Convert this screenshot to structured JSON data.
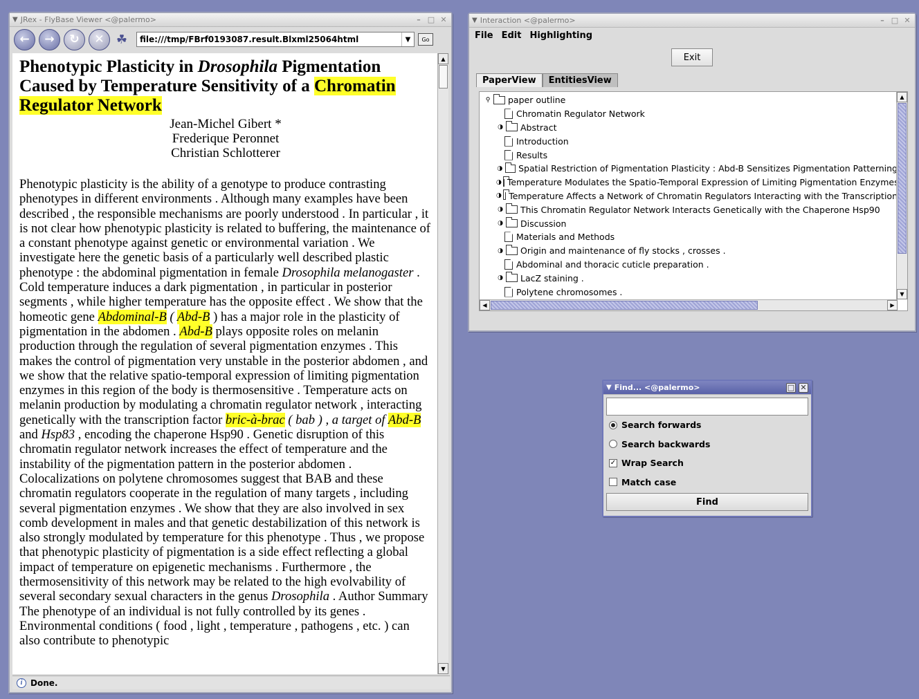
{
  "jrex": {
    "title": "JRex - FlyBase Viewer <@palermo>",
    "url": "file:///tmp/FBrf0193087.result.Blxml25064html",
    "go_label": "Go",
    "status": "Done.",
    "nav_icons": [
      "back-icon",
      "forward-icon",
      "reload-icon",
      "stop-icon",
      "home-icon"
    ]
  },
  "paper": {
    "title_plain_1": "Phenotypic Plasticity in ",
    "title_italic": "Drosophila",
    "title_plain_2": " Pigmentation Caused by Temperature Sensitivity of a ",
    "title_highlight": "Chromatin Regulator Network",
    "authors": [
      "Jean-Michel Gibert *",
      "Frederique Peronnet",
      "Christian Schlotterer"
    ],
    "abstract": {
      "p1": "Phenotypic plasticity is the ability of a genotype to produce contrasting phenotypes in different environments . Although many examples have been described , the responsible mechanisms are poorly understood . In particular , it is not clear how phenotypic plasticity is related to buffering, the maintenance of a constant phenotype against genetic or environmental variation . We investigate here the genetic basis of a particularly well described plastic phenotype : the abdominal pigmentation in female ",
      "i1": "Drosophila melanogaster",
      "p2": " . Cold temperature induces a dark pigmentation , in particular in posterior segments , while higher temperature has the opposite effect . We show that the homeotic gene ",
      "h1": "Abdominal-B",
      "p3": " ( ",
      "h2": "Abd-B",
      "p4": " ) has a major role in the plasticity of pigmentation in the abdomen . ",
      "h3": "Abd-B",
      "p5": " plays opposite roles on melanin production through the regulation of several pigmentation enzymes . This makes the control of pigmentation very unstable in the posterior abdomen , and we show that the relative spatio-temporal expression of limiting pigmentation enzymes in this region of the body is thermosensitive . Temperature acts on melanin production by modulating a chromatin regulator network , interacting genetically with the transcription factor ",
      "h4": "bric-à-brac",
      "p6": " ( bab ) , a target of ",
      "h5": "Abd-B",
      "p7": " and ",
      "i2": "Hsp83",
      "p8": " , encoding the chaperone Hsp90 . Genetic disruption of this chromatin regulator network increases the effect of temperature and the instability of the pigmentation pattern in the posterior abdomen . Colocalizations on polytene chromosomes suggest that BAB and these chromatin regulators cooperate in the regulation of many targets , including several pigmentation enzymes . We show that they are also involved in sex comb development in males and that genetic destabilization of this network is also strongly modulated by temperature for this phenotype . Thus , we propose that phenotypic plasticity of pigmentation is a side effect reflecting a global impact of temperature on epigenetic mechanisms . Furthermore , the thermosensitivity of this network may be related to the high evolvability of several secondary sexual characters in the genus ",
      "i3": "Drosophila",
      "p9": " . Author Summary The phenotype of an individual is not fully controlled by its genes . Environmental conditions ( food , light , temperature , pathogens , etc. ) can also contribute to phenotypic"
    }
  },
  "interaction": {
    "title": "Interaction <@palermo>",
    "menu": [
      "File",
      "Edit",
      "Highlighting"
    ],
    "exit_label": "Exit",
    "tabs": [
      "PaperView",
      "EntitiesView"
    ],
    "tree": [
      {
        "label": "paper outline",
        "type": "folder",
        "toggle": "open"
      },
      {
        "label": "Chromatin Regulator Network",
        "type": "doc"
      },
      {
        "label": "Abstract",
        "type": "folder",
        "toggle": "closed"
      },
      {
        "label": "Introduction",
        "type": "doc"
      },
      {
        "label": "Results",
        "type": "doc"
      },
      {
        "label": "Spatial Restriction of Pigmentation Plasticity : Abd-B Sensitizes  Pigmentation  Patterning",
        "type": "folder",
        "toggle": "closed"
      },
      {
        "label": "Temperature Modulates the Spatio-Temporal Expression of Limiting Pigmentation Enzymes",
        "type": "folder",
        "toggle": "closed"
      },
      {
        "label": "Temperature Affects a Network of Chromatin Regulators Interacting with the Transcription",
        "type": "folder",
        "toggle": "closed"
      },
      {
        "label": "This Chromatin Regulator Network Interacts Genetically with the Chaperone Hsp90",
        "type": "folder",
        "toggle": "closed"
      },
      {
        "label": "Discussion",
        "type": "folder",
        "toggle": "closed"
      },
      {
        "label": "Materials and Methods",
        "type": "doc"
      },
      {
        "label": "Origin and maintenance of fly stocks , crosses .",
        "type": "folder",
        "toggle": "closed"
      },
      {
        "label": "Abdominal and thoracic cuticle preparation .",
        "type": "doc"
      },
      {
        "label": "LacZ staining  .",
        "type": "folder",
        "toggle": "closed"
      },
      {
        "label": "Polytene chromosomes .",
        "type": "doc"
      }
    ]
  },
  "find": {
    "title": "Find... <@palermo>",
    "input_value": "",
    "options": [
      {
        "label": "Search forwards",
        "kind": "radio",
        "checked": true
      },
      {
        "label": "Search backwards",
        "kind": "radio",
        "checked": false
      },
      {
        "label": "Wrap Search",
        "kind": "check",
        "checked": true
      },
      {
        "label": "Match case",
        "kind": "check",
        "checked": false
      }
    ],
    "find_label": "Find"
  },
  "colors": {
    "desktop": "#7f86b8",
    "highlight": "#ffff29",
    "active_title": "#5a62a8"
  }
}
